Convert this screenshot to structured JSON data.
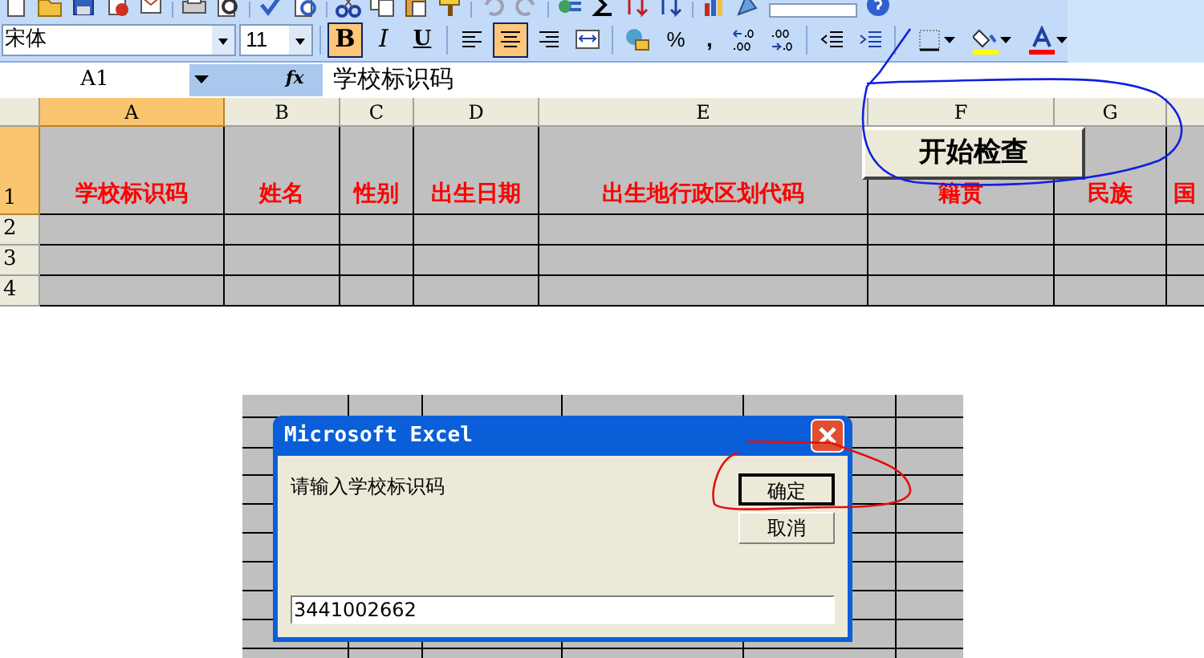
{
  "formatting_toolbar": {
    "font": "宋体",
    "size": "11",
    "buttons": [
      {
        "kind": "bold",
        "label": "B",
        "selected": true
      },
      {
        "kind": "italic",
        "label": "I",
        "selected": false
      },
      {
        "kind": "underline",
        "label": "U",
        "selected": false
      },
      {
        "kind": "align-left",
        "selected": false
      },
      {
        "kind": "align-center",
        "selected": true
      },
      {
        "kind": "align-right",
        "selected": false
      },
      {
        "kind": "merge",
        "selected": false
      },
      {
        "kind": "currency",
        "selected": false
      },
      {
        "kind": "percent",
        "label": "%",
        "selected": false
      },
      {
        "kind": "comma",
        "label": ",",
        "selected": false
      },
      {
        "kind": "increase-decimal",
        "selected": false
      },
      {
        "kind": "decrease-decimal",
        "selected": false
      },
      {
        "kind": "outdent",
        "selected": false
      },
      {
        "kind": "indent",
        "selected": false
      },
      {
        "kind": "borders",
        "selected": false
      },
      {
        "kind": "fill-color",
        "selected": false,
        "color": "#ffff00"
      },
      {
        "kind": "font-color",
        "selected": false,
        "color": "#ff0000"
      }
    ]
  },
  "formula_bar": {
    "cell": "A1",
    "fx": "fx",
    "content": "学校标识码"
  },
  "sheet": {
    "columns": [
      {
        "label": "A",
        "selected": true
      },
      {
        "label": "B",
        "selected": false
      },
      {
        "label": "C",
        "selected": false
      },
      {
        "label": "D",
        "selected": false
      },
      {
        "label": "E",
        "selected": false
      },
      {
        "label": "F",
        "selected": false
      },
      {
        "label": "G",
        "selected": false
      },
      {
        "selected": false
      }
    ],
    "rows": [
      {
        "label": "1",
        "selected": true,
        "cells": [
          "学校标识码",
          "姓名",
          "性别",
          "出生日期",
          "出生地行政区划代码",
          "籍贯",
          "民族",
          "国"
        ]
      },
      {
        "label": "2",
        "selected": false,
        "cells": []
      },
      {
        "label": "3",
        "selected": false,
        "cells": []
      },
      {
        "label": "4",
        "selected": false,
        "cells": []
      }
    ],
    "start_button": "开始检查"
  },
  "dialog": {
    "title": "Microsoft Excel",
    "prompt": "请输入学校标识码",
    "buttons": [
      {
        "label": "确定",
        "default": true
      },
      {
        "label": "取消",
        "default": false
      }
    ],
    "value": "3441002662"
  }
}
